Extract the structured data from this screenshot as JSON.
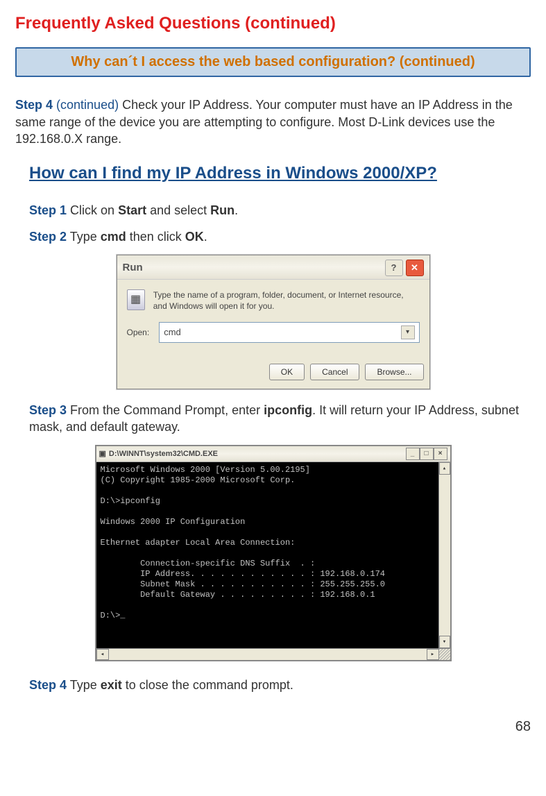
{
  "title": "Frequently Asked Questions (continued)",
  "box_heading": "Why can´t I access the web based configuration? (continued)",
  "intro": {
    "step_label": "Step 4",
    "continued": " (continued) ",
    "text": "Check your IP Address. Your computer must have an IP Address in the same range of the device you are attempting to configure. Most D-Link devices use the 192.168.0.X range."
  },
  "subhead": "How can I find my IP Address in Windows 2000/XP?",
  "step1": {
    "label": "Step 1",
    "pre": " Click on ",
    "b1": "Start",
    "mid": " and select ",
    "b2": "Run",
    "post": "."
  },
  "step2": {
    "label": "Step 2",
    "pre": " Type ",
    "b1": "cmd",
    "mid": " then click ",
    "b2": "OK",
    "post": "."
  },
  "run": {
    "title": "Run",
    "help": "?",
    "close": "✕",
    "desc": "Type the name of a program, folder, document, or Internet resource, and Windows will open it for you.",
    "open_label": "Open:",
    "value": "cmd",
    "ok": "OK",
    "cancel": "Cancel",
    "browse": "Browse..."
  },
  "step3": {
    "label": "Step 3",
    "pre": " From the Command Prompt, enter ",
    "b1": "ipconfig",
    "post": ". It will return your IP Address, subnet mask, and default gateway."
  },
  "cmd": {
    "title": "D:\\WINNT\\system32\\CMD.EXE",
    "content": "Microsoft Windows 2000 [Version 5.00.2195]\n(C) Copyright 1985-2000 Microsoft Corp.\n\nD:\\>ipconfig\n\nWindows 2000 IP Configuration\n\nEthernet adapter Local Area Connection:\n\n        Connection-specific DNS Suffix  . :\n        IP Address. . . . . . . . . . . . : 192.168.0.174\n        Subnet Mask . . . . . . . . . . . : 255.255.255.0\n        Default Gateway . . . . . . . . . : 192.168.0.1\n\nD:\\>_"
  },
  "step4": {
    "label": "Step 4",
    "pre": " Type ",
    "b1": "exit",
    "post": " to close the command prompt."
  },
  "pagenum": "68"
}
